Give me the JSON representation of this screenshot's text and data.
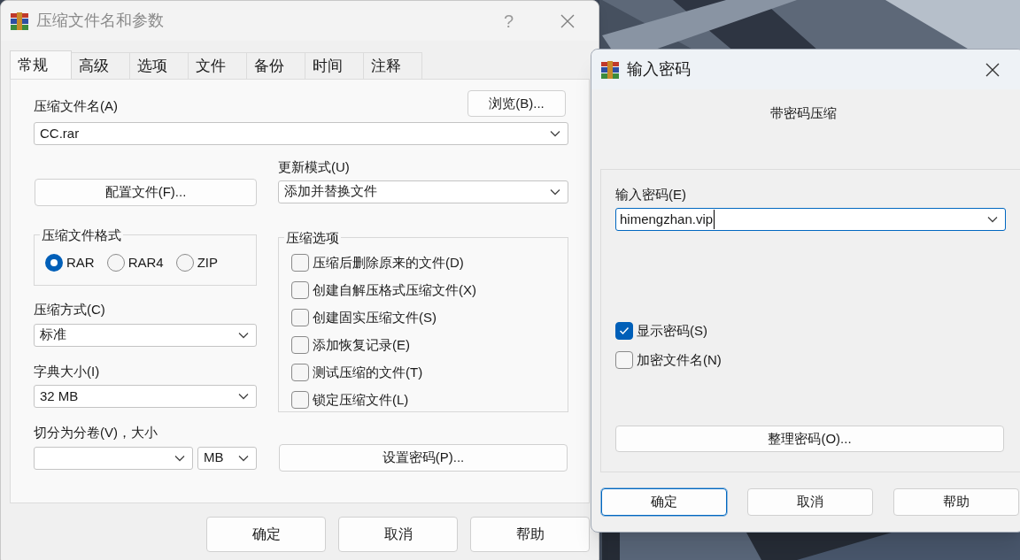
{
  "archive_dialog": {
    "title": "压缩文件名和参数",
    "help": "?",
    "tabs": [
      {
        "label": "常规",
        "selected": true
      },
      {
        "label": "高级",
        "selected": false
      },
      {
        "label": "选项",
        "selected": false
      },
      {
        "label": "文件",
        "selected": false
      },
      {
        "label": "备份",
        "selected": false
      },
      {
        "label": "时间",
        "selected": false
      },
      {
        "label": "注释",
        "selected": false
      }
    ],
    "archive_name": {
      "label": "压缩文件名(A)",
      "value": "CC.rar",
      "browse_button": "浏览(B)..."
    },
    "profiles_button": "配置文件(F)...",
    "update_mode": {
      "label": "更新模式(U)",
      "value": "添加并替换文件"
    },
    "archive_format": {
      "title": "压缩文件格式",
      "options": [
        {
          "label": "RAR",
          "selected": true
        },
        {
          "label": "RAR4",
          "selected": false
        },
        {
          "label": "ZIP",
          "selected": false
        }
      ]
    },
    "archiving_options": {
      "title": "压缩选项",
      "items": [
        {
          "label": "压缩后删除原来的文件(D)",
          "checked": false
        },
        {
          "label": "创建自解压格式压缩文件(X)",
          "checked": false
        },
        {
          "label": "创建固实压缩文件(S)",
          "checked": false
        },
        {
          "label": "添加恢复记录(E)",
          "checked": false
        },
        {
          "label": "测试压缩的文件(T)",
          "checked": false
        },
        {
          "label": "锁定压缩文件(L)",
          "checked": false
        }
      ]
    },
    "compression_method": {
      "label": "压缩方式(C)",
      "value": "标准"
    },
    "dictionary_size": {
      "label": "字典大小(I)",
      "value": "32 MB"
    },
    "split": {
      "label": "切分为分卷(V)，大小",
      "unit": "MB"
    },
    "set_password_button": "设置密码(P)...",
    "buttons": [
      {
        "label": "确定"
      },
      {
        "label": "取消"
      },
      {
        "label": "帮助"
      }
    ]
  },
  "password_dialog": {
    "title": "输入密码",
    "heading": "带密码压缩",
    "password": {
      "label": "输入密码(E)",
      "value": "himengzhan.vip"
    },
    "options": [
      {
        "label": "显示密码(S)",
        "checked": true
      },
      {
        "label": "加密文件名(N)",
        "checked": false
      }
    ],
    "organize_button": "整理密码(O)...",
    "buttons": [
      {
        "label": "确定",
        "default": true
      },
      {
        "label": "取消",
        "default": false
      },
      {
        "label": "帮助",
        "default": false
      }
    ]
  }
}
